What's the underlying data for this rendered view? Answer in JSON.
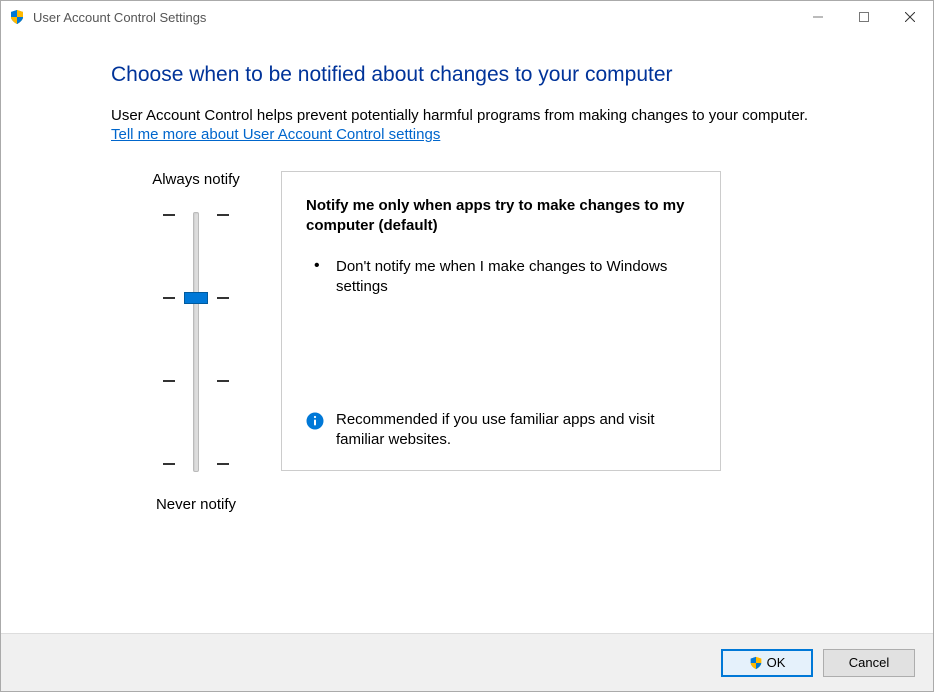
{
  "window": {
    "title": "User Account Control Settings"
  },
  "heading": "Choose when to be notified about changes to your computer",
  "subtext": "User Account Control helps prevent potentially harmful programs from making changes to your computer.",
  "link": "Tell me more about User Account Control settings",
  "slider": {
    "top_label": "Always notify",
    "bottom_label": "Never notify",
    "levels": 4,
    "level_index": 1
  },
  "infobox": {
    "title": "Notify me only when apps try to make changes to my computer (default)",
    "bullets": [
      "Don't notify me when I make changes to Windows settings"
    ],
    "footer": "Recommended if you use familiar apps and visit familiar websites."
  },
  "buttons": {
    "ok": "OK",
    "cancel": "Cancel"
  }
}
